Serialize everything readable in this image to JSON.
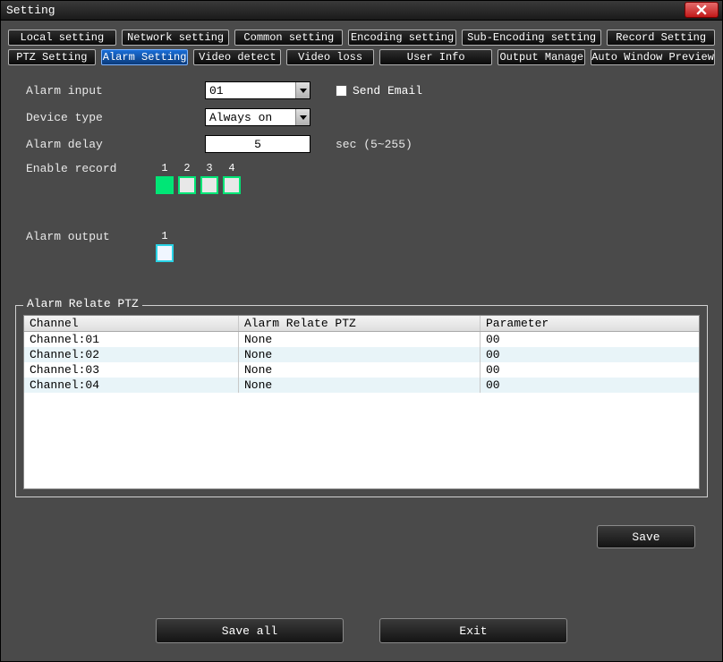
{
  "window": {
    "title": "Setting"
  },
  "tabs_row1": [
    "Local setting",
    "Network setting",
    "Common setting",
    "Encoding setting",
    "Sub-Encoding setting",
    "Record Setting"
  ],
  "tabs_row2": [
    "PTZ Setting",
    "Alarm Setting",
    "Video detect",
    "Video loss",
    "User Info",
    "Output Manage",
    "Auto Window Preview"
  ],
  "active_tab": "Alarm Setting",
  "form": {
    "alarm_input_label": "Alarm input",
    "alarm_input_value": "01",
    "send_email_label": "Send Email",
    "send_email_checked": false,
    "device_type_label": "Device type",
    "device_type_value": "Always on",
    "alarm_delay_label": "Alarm delay",
    "alarm_delay_value": "5",
    "alarm_delay_hint": "sec (5~255)",
    "enable_record_label": "Enable record",
    "record_channels": [
      {
        "num": "1",
        "on": true
      },
      {
        "num": "2",
        "on": false
      },
      {
        "num": "3",
        "on": false
      },
      {
        "num": "4",
        "on": false
      }
    ],
    "alarm_output_label": "Alarm output",
    "alarm_output_channels": [
      {
        "num": "1",
        "on": false
      }
    ]
  },
  "ptz_table": {
    "legend": "Alarm Relate PTZ",
    "headers": {
      "channel": "Channel",
      "ptz": "Alarm Relate PTZ",
      "param": "Parameter"
    },
    "rows": [
      {
        "channel": "Channel:01",
        "ptz": "None",
        "param": "00"
      },
      {
        "channel": "Channel:02",
        "ptz": "None",
        "param": "00"
      },
      {
        "channel": "Channel:03",
        "ptz": "None",
        "param": "00"
      },
      {
        "channel": "Channel:04",
        "ptz": "None",
        "param": "00"
      }
    ]
  },
  "buttons": {
    "save": "Save",
    "save_all": "Save all",
    "exit": "Exit"
  }
}
